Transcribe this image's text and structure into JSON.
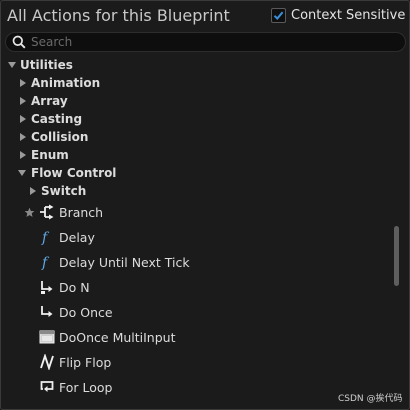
{
  "header": {
    "title": "All Actions for this Blueprint",
    "context_sensitive_label": "Context Sensitive",
    "context_sensitive_checked": true
  },
  "search": {
    "placeholder": "Search",
    "value": ""
  },
  "tree": {
    "root": {
      "label": "Utilities",
      "expanded": true
    },
    "categories": [
      {
        "label": "Animation",
        "expanded": false
      },
      {
        "label": "Array",
        "expanded": false
      },
      {
        "label": "Casting",
        "expanded": false
      },
      {
        "label": "Collision",
        "expanded": false
      },
      {
        "label": "Enum",
        "expanded": false
      }
    ],
    "flow_control": {
      "label": "Flow Control",
      "expanded": true,
      "switch": {
        "label": "Switch",
        "expanded": false
      },
      "items": [
        {
          "label": "Branch",
          "icon": "branch-icon",
          "favorite_icon": "star-icon"
        },
        {
          "label": "Delay",
          "icon": "function-icon"
        },
        {
          "label": "Delay Until Next Tick",
          "icon": "function-icon"
        },
        {
          "label": "Do N",
          "icon": "do-n-icon"
        },
        {
          "label": "Do Once",
          "icon": "do-once-icon"
        },
        {
          "label": "DoOnce MultiInput",
          "icon": "multi-input-icon"
        },
        {
          "label": "Flip Flop",
          "icon": "flip-flop-icon"
        },
        {
          "label": "For Loop",
          "icon": "loop-icon"
        }
      ]
    }
  },
  "colors": {
    "background": "#1b1b1b",
    "checkbox_tick": "#3b8fd9",
    "function_icon": "#5fa9e6",
    "text": "#dcdcdc"
  },
  "watermark": "CSDN @挨代码"
}
